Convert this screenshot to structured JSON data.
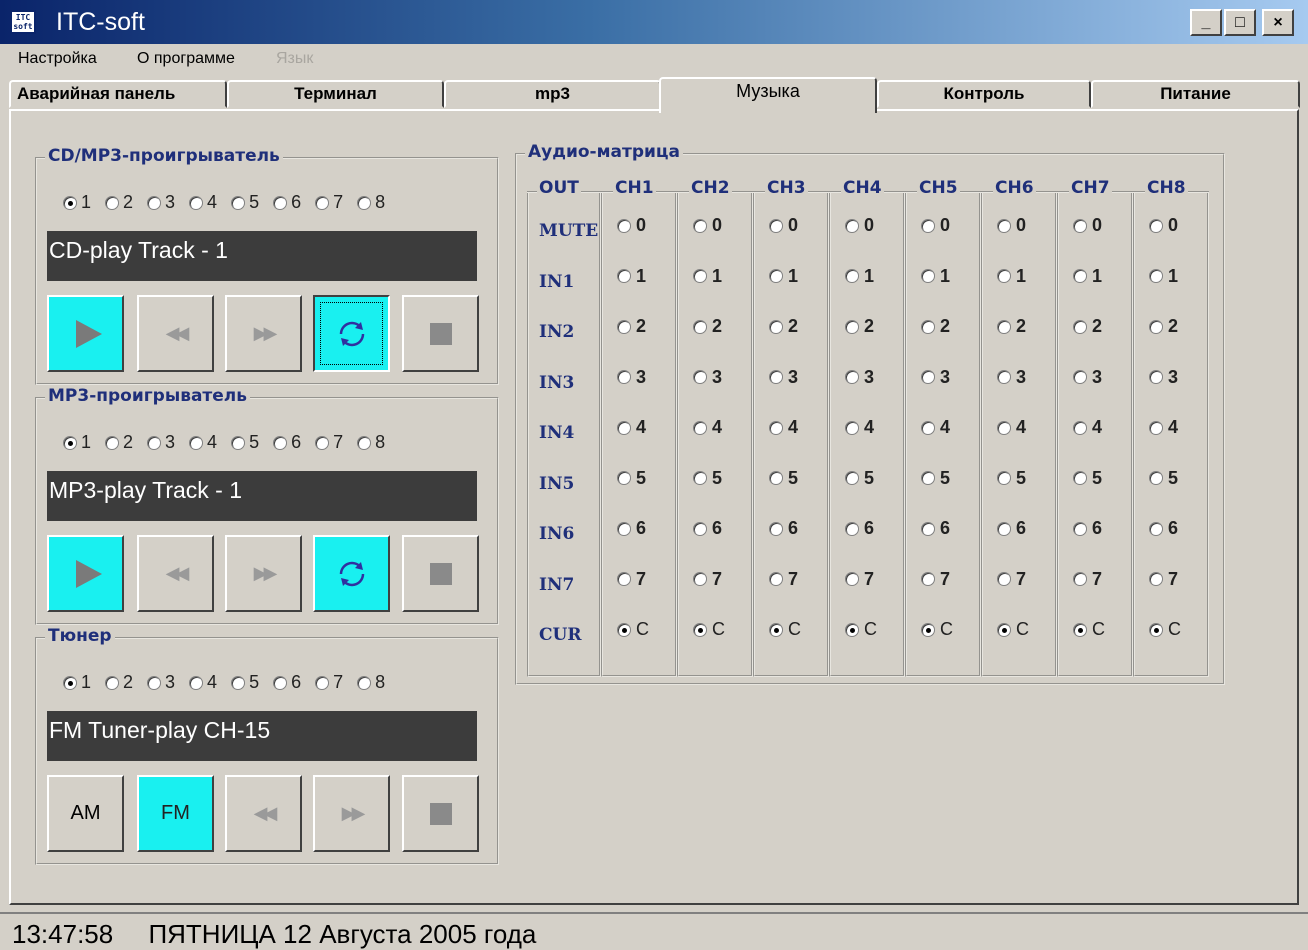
{
  "window": {
    "title": "ITC-soft",
    "icon_text": "ITC soft",
    "buttons": {
      "minimize": "_",
      "maximize": "□",
      "close": "×"
    }
  },
  "menu": [
    {
      "label": "Настройка",
      "enabled": true
    },
    {
      "label": "О программе",
      "enabled": true
    },
    {
      "label": "Язык",
      "enabled": false
    }
  ],
  "tabs": [
    {
      "label": "Аварийная панель",
      "active": false
    },
    {
      "label": "Терминал",
      "active": false
    },
    {
      "label": "mp3",
      "active": false
    },
    {
      "label": "Музыка",
      "active": true
    },
    {
      "label": "Контроль",
      "active": false
    },
    {
      "label": "Питание",
      "active": false
    }
  ],
  "cd_player": {
    "title": "CD/MP3-проигрыватель",
    "options": [
      "1",
      "2",
      "3",
      "4",
      "5",
      "6",
      "7",
      "8"
    ],
    "selected": "1",
    "display": "CD-play Track - 1",
    "buttons": [
      "play-icon",
      "rewind-icon",
      "forward-icon",
      "repeat-icon",
      "stop-icon"
    ],
    "active": [
      "play",
      "repeat"
    ]
  },
  "mp3_player": {
    "title": "MP3-проигрыватель",
    "options": [
      "1",
      "2",
      "3",
      "4",
      "5",
      "6",
      "7",
      "8"
    ],
    "selected": "1",
    "display": "MP3-play Track - 1",
    "active": [
      "play",
      "repeat"
    ]
  },
  "tuner": {
    "title": "Тюнер",
    "options": [
      "1",
      "2",
      "3",
      "4",
      "5",
      "6",
      "7",
      "8"
    ],
    "selected": "1",
    "display": "FM Tuner-play CH-15",
    "am_label": "AM",
    "fm_label": "FM",
    "active": [
      "fm"
    ]
  },
  "matrix": {
    "title": "Аудио-матрица",
    "out_label": "OUT",
    "channels": [
      "CH1",
      "CH2",
      "CH3",
      "CH4",
      "CH5",
      "CH6",
      "CH7",
      "CH8"
    ],
    "rows": [
      {
        "label": "MUTE",
        "value": "0"
      },
      {
        "label": "IN1",
        "value": "1"
      },
      {
        "label": "IN2",
        "value": "2"
      },
      {
        "label": "IN3",
        "value": "3"
      },
      {
        "label": "IN4",
        "value": "4"
      },
      {
        "label": "IN5",
        "value": "5"
      },
      {
        "label": "IN6",
        "value": "6"
      },
      {
        "label": "IN7",
        "value": "7"
      },
      {
        "label": "CUR",
        "value": "C"
      }
    ],
    "selected_row": "CUR"
  },
  "status": {
    "time": "13:47:58",
    "date": "ПЯТНИЦА 12 Августа 2005 года"
  },
  "colors": {
    "accent_cyan": "#19f0f0",
    "display_bg": "#3c3c3c",
    "label_blue": "#1f2f7a"
  }
}
